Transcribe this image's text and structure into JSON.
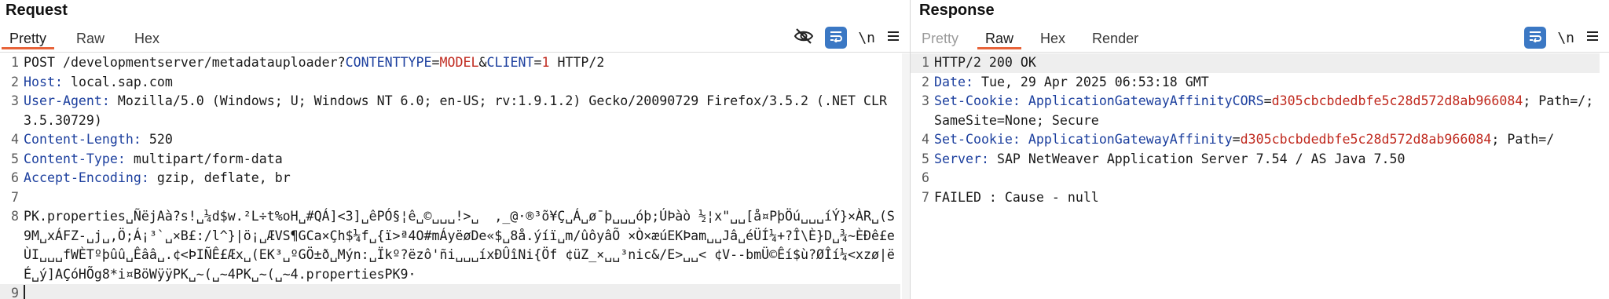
{
  "request": {
    "title": "Request",
    "tabs": [
      "Pretty",
      "Raw",
      "Hex"
    ],
    "active_tab": "Pretty",
    "line1": {
      "method": "POST",
      "path": "/developmentserver/metadatauploader?",
      "p1_key": "CONTENTTYPE",
      "p1_val": "MODEL",
      "amp": "&",
      "p2_key": "CLIENT",
      "p2_val": "1",
      "proto": "HTTP/2"
    },
    "headers": [
      {
        "name": "Host",
        "value": "local.sap.com"
      },
      {
        "name": "User-Agent",
        "value": "Mozilla/5.0 (Windows; U; Windows NT 6.0; en-US; rv:1.9.1.2) Gecko/20090729 Firefox/3.5.2 (.NET CLR 3.5.30729)"
      },
      {
        "name": "Content-Length",
        "value": "520"
      },
      {
        "name": "Content-Type",
        "value": "multipart/form-data"
      },
      {
        "name": "Accept-Encoding",
        "value": "gzip, deflate, br"
      }
    ],
    "body": "PK.properties␣ÑëjAà?s!␣¼d$w.²L÷t%oH␣#QÁ]<3]␣êPÓ§¦ê␣©␣␣␣!>␣  ,_@·®³õ¥Ç␣Á␣ø¯þ␣␣␣óþ;ÚÞàò ½¦x\"␣␣[å¤PþÖú␣␣␣íÝ}×ÀR␣(S9M␣xÁFZ-␣j␣,Ö;Á¡³`␣×B£:/l^}|ö¡␣ÆVS¶GCa×Çh$¼f␣{ï>ª4O#mÁyëøDe«$␣8å.ýíï␣m/ûôyâÕ ×Ò×æúEKÞam␣␣Jâ␣éÜÍ¼+?Î\\È}D␣¾~ÈÐê£eÙI␣␣␣fWÈTºþûû␣Êââ␣.¢<ÞIÑÊ£Æx␣(EK³␣ºGÖ±ð␣Mýn:␣Ïkº?ëzô'ñi␣␣␣íxÐÛîNi{Öf ¢üZ_×␣␣³nic&/E>␣␣< ¢V--bmÜ©Êí$ù?ØÎí¼<xzø|ëÉ␣ý]AÇóHÕg8*i¤BöWÿÿPK␣~(␣~4PK␣~(␣~4.propertiesPK9·"
  },
  "response": {
    "title": "Response",
    "tabs": [
      "Pretty",
      "Raw",
      "Hex",
      "Render"
    ],
    "active_tab": "Raw",
    "status": "HTTP/2 200 OK",
    "date": {
      "name": "Date",
      "value": "Tue, 29 Apr 2025 06:53:18 GMT"
    },
    "cookie1": {
      "name": "Set-Cookie",
      "key": "ApplicationGatewayAffinityCORS",
      "eq": "=",
      "val": "d305cbcbdedbfe5c28d572d8ab966084",
      "rest": "; Path=/; SameSite=None; Secure"
    },
    "cookie2": {
      "name": "Set-Cookie",
      "key": "ApplicationGatewayAffinity",
      "eq": "=",
      "val": "d305cbcbdedbfe5c28d572d8ab966084",
      "rest": "; Path=/"
    },
    "server": {
      "name": "Server",
      "value": "SAP NetWeaver Application Server 7.54 / AS Java 7.50"
    },
    "body": "FAILED : Cause - null"
  },
  "line_numbers": [
    "1",
    "2",
    "3",
    "4",
    "5",
    "6",
    "7",
    "8",
    "9"
  ],
  "icons": {
    "hide": "eye-slash-icon",
    "wrap": "word-wrap-icon",
    "newline_glyph": "\\n",
    "menu": "hamburger-menu-icon"
  },
  "colors": {
    "header_name": "#1c3f9e",
    "param_value": "#c02a1f",
    "active_tab_underline": "#e8643a",
    "wrap_button": "#3b78c4"
  }
}
